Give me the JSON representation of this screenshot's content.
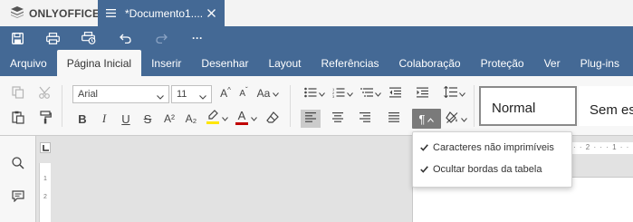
{
  "app": {
    "brand": "ONLYOFFICE",
    "document_title": "*Documento1...."
  },
  "quick_access": {
    "icons": [
      "save-icon",
      "print-icon",
      "quick-print-icon",
      "undo-icon",
      "redo-icon",
      "more-icon"
    ],
    "more_label": "···"
  },
  "tabs": [
    {
      "label": "Arquivo",
      "active": false
    },
    {
      "label": "Página Inicial",
      "active": true
    },
    {
      "label": "Inserir",
      "active": false
    },
    {
      "label": "Desenhar",
      "active": false
    },
    {
      "label": "Layout",
      "active": false
    },
    {
      "label": "Referências",
      "active": false
    },
    {
      "label": "Colaboração",
      "active": false
    },
    {
      "label": "Proteção",
      "active": false
    },
    {
      "label": "Ver",
      "active": false
    },
    {
      "label": "Plug-ins",
      "active": false
    }
  ],
  "font": {
    "family": "Arial",
    "size": "11"
  },
  "format_buttons": {
    "bold": "B",
    "italic": "I",
    "underline": "U",
    "strike": "S",
    "superscript": "A²",
    "subscript": "A₂",
    "font_color": "A",
    "case": "Aa",
    "grow": "A",
    "shrink": "A"
  },
  "colors": {
    "highlight": "#ffe600",
    "font_color": "#c00000",
    "accent": "#446995"
  },
  "styles": {
    "normal": "Normal",
    "no_spacing": "Sem es"
  },
  "dropdown": {
    "items": [
      {
        "label": "Caracteres não imprimíveis",
        "checked": true
      },
      {
        "label": "Ocultar bordas da tabela",
        "checked": true
      }
    ]
  },
  "ruler": {
    "hmarks": "· · 2 · · · 1 · · ·",
    "vmarks": [
      "1",
      "2"
    ]
  }
}
